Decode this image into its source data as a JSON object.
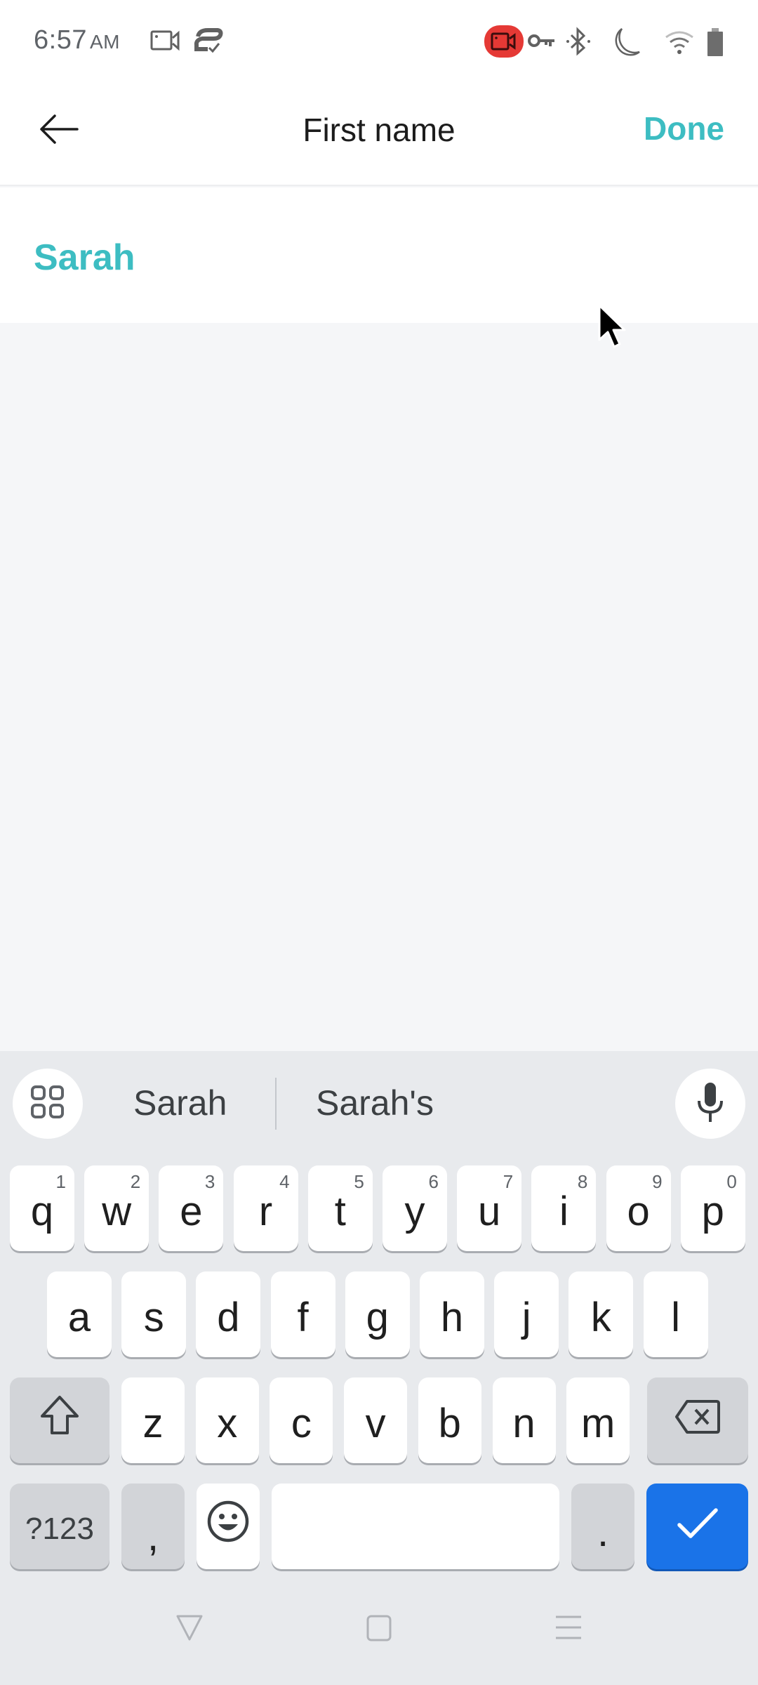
{
  "status_bar": {
    "time": "6:57",
    "ampm": "AM",
    "icons": [
      "screen-record-icon",
      "sync-check-icon",
      "recording-active-icon",
      "vpn-key-icon",
      "bluetooth-icon",
      "do-not-disturb-moon-icon",
      "wifi-icon",
      "battery-icon"
    ],
    "recording_color": "#E53935"
  },
  "app_bar": {
    "back_icon": "arrow-left-icon",
    "title": "First name",
    "done_label": "Done",
    "accent_color": "#3DBDC2"
  },
  "form": {
    "first_name_value": "Sarah"
  },
  "keyboard": {
    "suggestions": [
      "Sarah",
      "Sarah's"
    ],
    "apps_icon": "grid-apps-icon",
    "mic_icon": "microphone-icon",
    "row1": [
      {
        "key": "q",
        "hint": "1"
      },
      {
        "key": "w",
        "hint": "2"
      },
      {
        "key": "e",
        "hint": "3"
      },
      {
        "key": "r",
        "hint": "4"
      },
      {
        "key": "t",
        "hint": "5"
      },
      {
        "key": "y",
        "hint": "6"
      },
      {
        "key": "u",
        "hint": "7"
      },
      {
        "key": "i",
        "hint": "8"
      },
      {
        "key": "o",
        "hint": "9"
      },
      {
        "key": "p",
        "hint": "0"
      }
    ],
    "row2": [
      "a",
      "s",
      "d",
      "f",
      "g",
      "h",
      "j",
      "k",
      "l"
    ],
    "row3": [
      "z",
      "x",
      "c",
      "v",
      "b",
      "n",
      "m"
    ],
    "symbols_label": "?123",
    "comma_label": ",",
    "period_label": ".",
    "enter_color": "#1A73E8"
  },
  "nav_bar": {
    "buttons": [
      "back-triangle-icon",
      "home-square-icon",
      "recents-menu-icon"
    ]
  }
}
